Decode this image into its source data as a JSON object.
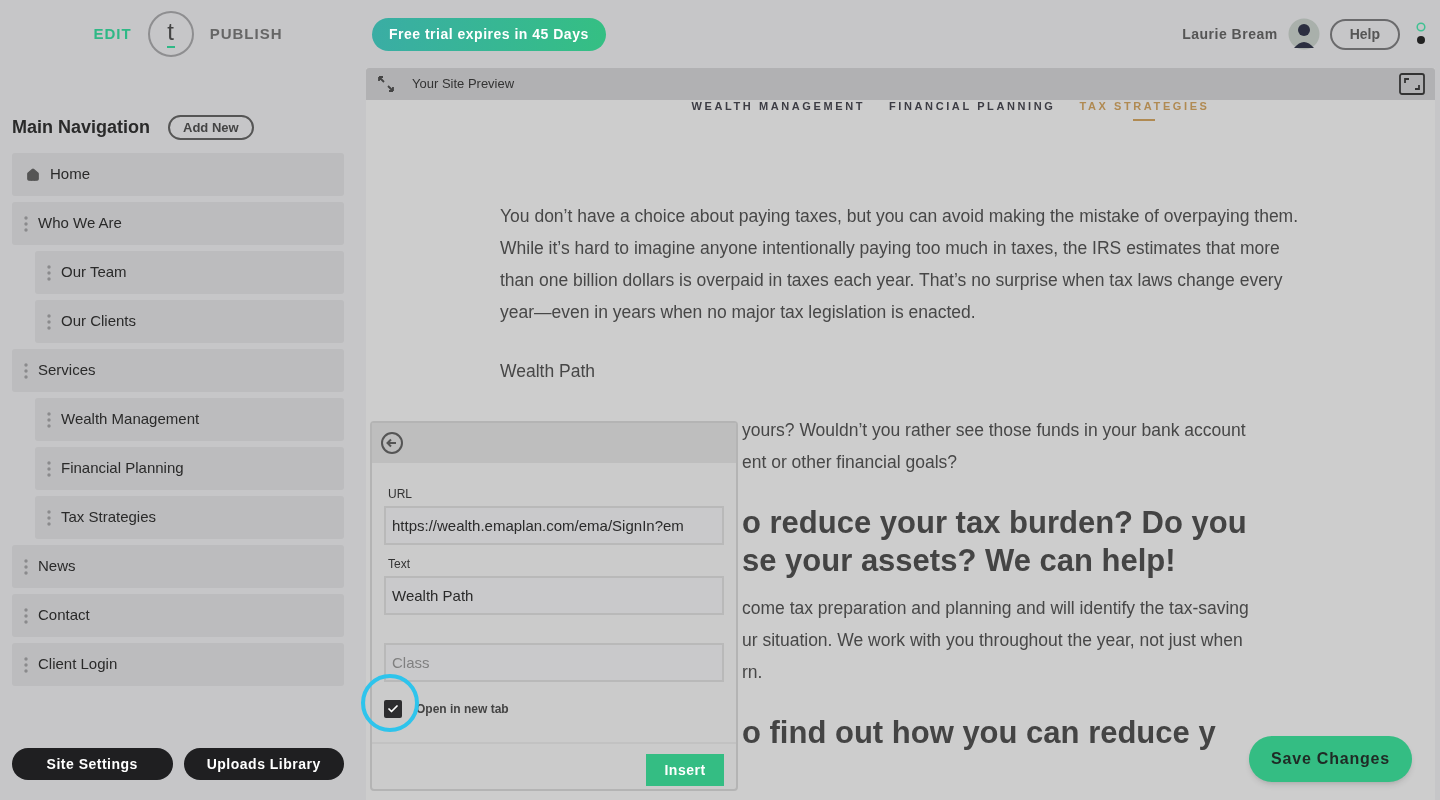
{
  "top_bar": {
    "edit": "EDIT",
    "logo": "t",
    "publish": "PUBLISH",
    "trial_badge": "Free trial expires in 45 Days",
    "user_name": "Laurie Bream",
    "help": "Help"
  },
  "sidebar": {
    "title": "Main Navigation",
    "add_button": "Add New",
    "items": [
      {
        "label": "Home",
        "kind": "home"
      },
      {
        "label": "Who We Are",
        "kind": "page",
        "children": [
          {
            "label": "Our Team",
            "kind": "page"
          },
          {
            "label": "Our Clients",
            "kind": "page"
          }
        ]
      },
      {
        "label": "Services",
        "kind": "page",
        "children": [
          {
            "label": "Wealth Management",
            "kind": "page"
          },
          {
            "label": "Financial Planning",
            "kind": "page"
          },
          {
            "label": "Tax Strategies",
            "kind": "page"
          }
        ]
      },
      {
        "label": "News",
        "kind": "page"
      },
      {
        "label": "Contact",
        "kind": "page"
      },
      {
        "label": "Client Login",
        "kind": "page"
      }
    ],
    "buttons": [
      "Site Settings",
      "Uploads Library"
    ]
  },
  "preview": {
    "title": "Your Site Preview",
    "nav": [
      {
        "label": "WEALTH MANAGEMENT",
        "selected": false
      },
      {
        "label": "FINANCIAL PLANNING",
        "selected": false
      },
      {
        "label": "TAX STRATEGIES",
        "selected": true
      }
    ],
    "content": [
      {
        "kind": "paragraph",
        "text": "You don’t have a choice about paying taxes, but you can avoid making the mistake of overpaying them. While it’s hard to imagine anyone intentionally paying too much in taxes, the IRS estimates that more than one billion dollars is overpaid in taxes each year. That’s no surprise when tax laws change every year—even in years when no major tax legislation is enacted."
      },
      {
        "kind": "paragraph",
        "text": "Wealth Path"
      },
      {
        "kind": "fragment",
        "text": "yours? Wouldn’t you rather see those funds in your bank account"
      },
      {
        "kind": "fragment",
        "text": "ent or other financial goals?"
      },
      {
        "kind": "heading-fragment",
        "text": "o reduce your tax burden? Do you"
      },
      {
        "kind": "heading-fragment",
        "text": "se your assets? We can help!"
      },
      {
        "kind": "fragment",
        "text": "come tax preparation and planning and will identify the tax-saving"
      },
      {
        "kind": "fragment",
        "text": "ur situation. We work with you throughout the year, not just when"
      },
      {
        "kind": "fragment",
        "text": "rn."
      },
      {
        "kind": "heading-fragment",
        "text": "o find out how you can reduce y"
      }
    ]
  },
  "link_dialog": {
    "url_label": "URL",
    "url_value": "https://wealth.emaplan.com/ema/SignIn?em",
    "text_label": "Text",
    "text_value": "Wealth Path",
    "class_placeholder": "Class",
    "open_new_tab": {
      "label": "Open in new tab",
      "checked": true
    },
    "insert": "Insert"
  },
  "save_button": "Save Changes"
}
